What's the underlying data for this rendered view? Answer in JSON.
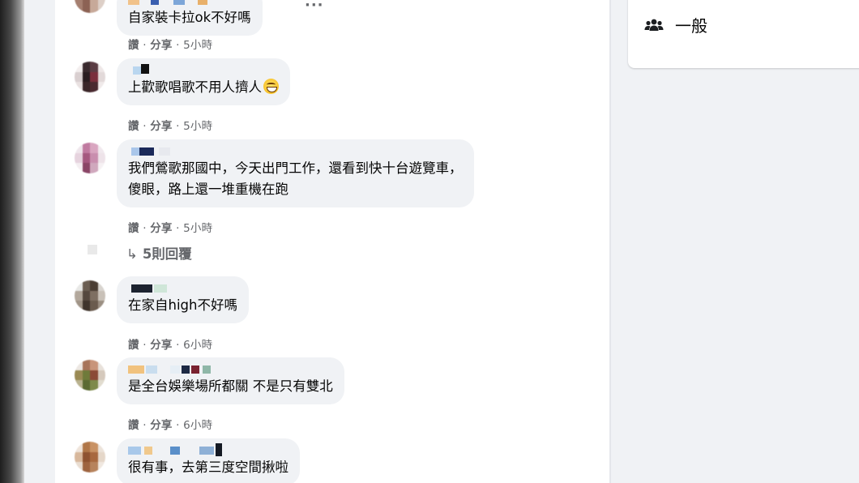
{
  "sidebar": {
    "category_icon": "group-icon",
    "category_label": "一般"
  },
  "comments": [
    {
      "text": "自家裝卡拉ok不好嗎",
      "actions": {
        "like": "讚",
        "share": "分享",
        "time": "5小時"
      },
      "more_icon": "more-dots-icon"
    },
    {
      "text": "上歡歌唱歌不用人擠人",
      "emoji": "grinning-face-emoji",
      "actions": {
        "like": "讚",
        "share": "分享",
        "time": "5小時"
      }
    },
    {
      "text_line1": "我們鶯歌那國中，今天出門工作，還看到快十台遊覽車，",
      "text_line2": "傻眼，路上還一堆重機在跑",
      "actions": {
        "like": "讚",
        "share": "分享",
        "time": "5小時"
      },
      "replies": {
        "icon": "reply-arrow-icon",
        "label": "5則回覆"
      }
    },
    {
      "text": "在家自high不好嗎",
      "actions": {
        "like": "讚",
        "share": "分享",
        "time": "6小時"
      }
    },
    {
      "text": "是全台娛樂場所都關 不是只有雙北",
      "actions": {
        "like": "讚",
        "share": "分享",
        "time": "6小時"
      }
    },
    {
      "text": "很有事，去第三度空間揪啦"
    }
  ],
  "separator": " · "
}
